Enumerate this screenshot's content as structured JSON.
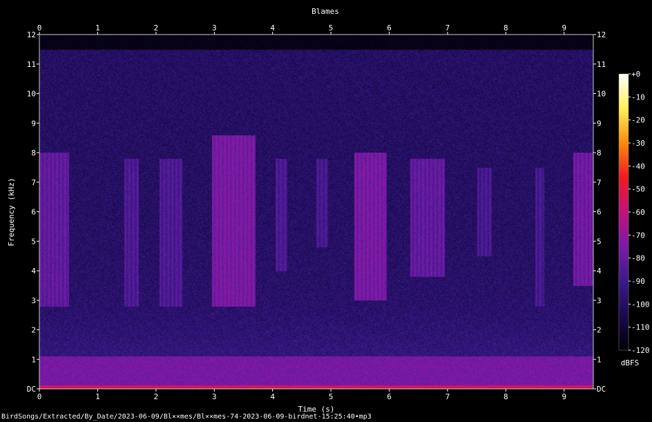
{
  "chart_data": {
    "type": "heatmap",
    "title": "Blames",
    "xlabel": "Time (s)",
    "ylabel": "Frequency (kHz)",
    "xlim": [
      0,
      9.5
    ],
    "ylim": [
      0,
      12
    ],
    "x_ticks": [
      "0",
      "1",
      "2",
      "3",
      "4",
      "5",
      "6",
      "7",
      "8",
      "9"
    ],
    "y_ticks": [
      "DC",
      "1",
      "2",
      "3",
      "4",
      "5",
      "6",
      "7",
      "8",
      "9",
      "10",
      "11",
      "12"
    ],
    "colorbar": {
      "label": "dBFS",
      "ticks": [
        "+0",
        "-10",
        "-20",
        "-30",
        "-40",
        "-50",
        "-60",
        "-70",
        "-80",
        "-90",
        "-100",
        "-110",
        "-120"
      ],
      "range": [
        -120,
        0
      ],
      "colors": [
        "#000000",
        "#1a0a4e",
        "#3a1a8a",
        "#7a1aa8",
        "#c0127a",
        "#f01a20",
        "#f88a10",
        "#fff05a",
        "#ffffff"
      ]
    },
    "energy_bands": [
      {
        "t_start": 0.0,
        "t_end": 0.5,
        "f_low": 2.8,
        "f_high": 8.0,
        "level_dbfs": -75
      },
      {
        "t_start": 1.45,
        "t_end": 1.7,
        "f_low": 2.8,
        "f_high": 7.8,
        "level_dbfs": -80
      },
      {
        "t_start": 2.05,
        "t_end": 2.45,
        "f_low": 2.8,
        "f_high": 7.8,
        "level_dbfs": -80
      },
      {
        "t_start": 2.95,
        "t_end": 3.7,
        "f_low": 2.8,
        "f_high": 8.6,
        "level_dbfs": -70
      },
      {
        "t_start": 4.05,
        "t_end": 4.25,
        "f_low": 4.0,
        "f_high": 7.8,
        "level_dbfs": -80
      },
      {
        "t_start": 4.75,
        "t_end": 4.95,
        "f_low": 4.8,
        "f_high": 7.8,
        "level_dbfs": -82
      },
      {
        "t_start": 5.4,
        "t_end": 5.95,
        "f_low": 3.0,
        "f_high": 8.0,
        "level_dbfs": -70
      },
      {
        "t_start": 6.35,
        "t_end": 6.95,
        "f_low": 3.8,
        "f_high": 7.8,
        "level_dbfs": -75
      },
      {
        "t_start": 7.5,
        "t_end": 7.75,
        "f_low": 4.5,
        "f_high": 7.5,
        "level_dbfs": -82
      },
      {
        "t_start": 8.5,
        "t_end": 8.65,
        "f_low": 2.8,
        "f_high": 7.5,
        "level_dbfs": -82
      },
      {
        "t_start": 9.15,
        "t_end": 9.5,
        "f_low": 3.5,
        "f_high": 8.0,
        "level_dbfs": -72
      }
    ],
    "low_frequency_band": {
      "f_low": 0,
      "f_high": 1.1,
      "level_dbfs": -70
    },
    "upper_cutoff_khz": 11.5
  },
  "footer_text": "BirdSongs/Extracted/By_Date/2023-06-09/Bl××mes/Bl××mes-74-2023-06-09-birdnet-15:25:40•mp3"
}
